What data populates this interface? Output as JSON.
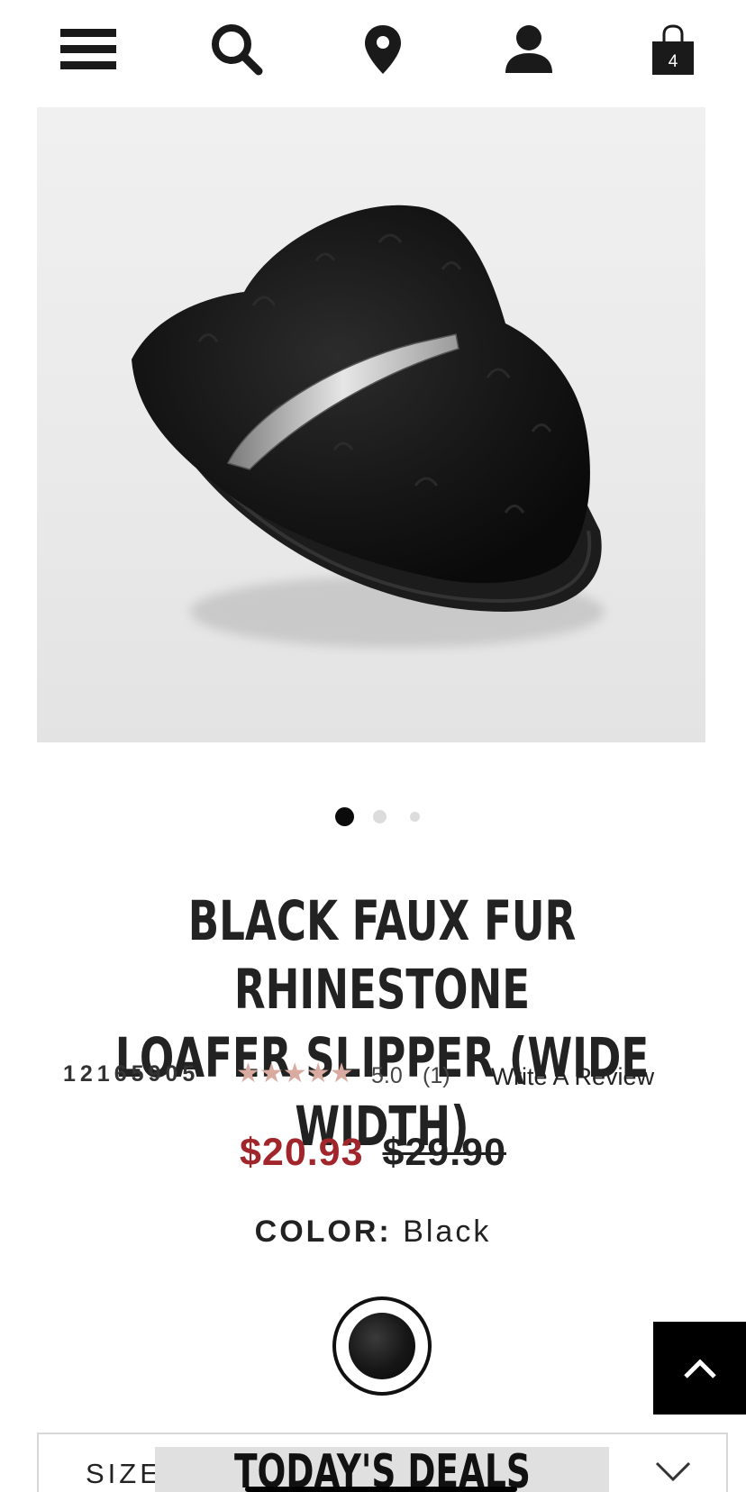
{
  "header": {
    "icons": [
      "menu-icon",
      "search-icon",
      "location-icon",
      "account-icon",
      "bag-icon"
    ],
    "bag_count": "4"
  },
  "carousel": {
    "slides": 3,
    "active": 1
  },
  "product": {
    "title_line1": "BLACK FAUX FUR RHINESTONE",
    "title_line2": "LOAFER SLIPPER (WIDE WIDTH)",
    "sku": "12165905",
    "stars": "★★★★★",
    "rating": "5.0",
    "review_count": "(1)",
    "write_review": "Write A Review",
    "price_sale": "$20.93",
    "price_original": "$29.90",
    "color_label": "COLOR:",
    "color_value": "Black"
  },
  "size": {
    "label": "SIZE:"
  },
  "deals": {
    "label": "TODAY'S DEALS"
  },
  "colors": {
    "sale_price": "#a1262b",
    "stars": "#d9aba0"
  }
}
